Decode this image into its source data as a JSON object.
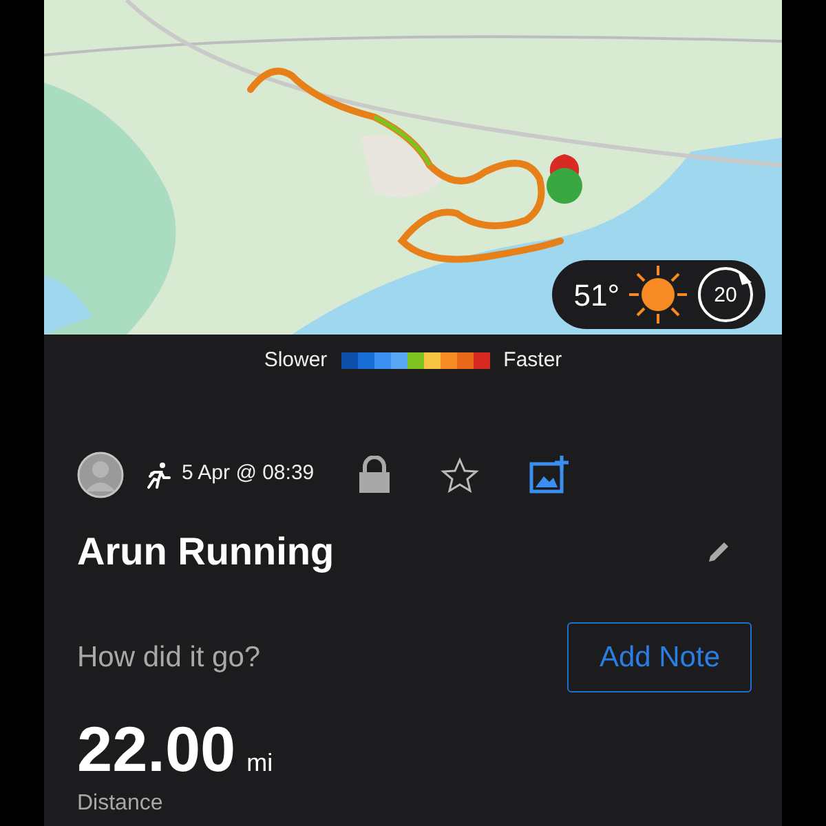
{
  "weather": {
    "temperature": "51°",
    "wind_speed": "20"
  },
  "speed_legend": {
    "slow_label": "Slower",
    "fast_label": "Faster",
    "swatches": [
      {
        "color": "#0d4fa8"
      },
      {
        "color": "#1a6fd6"
      },
      {
        "color": "#3b8ff0"
      },
      {
        "color": "#5aa8f5"
      },
      {
        "color": "#7ec322"
      },
      {
        "color": "#f9c544"
      },
      {
        "color": "#f68a24"
      },
      {
        "color": "#e8681a"
      },
      {
        "color": "#d72a22"
      }
    ]
  },
  "activity": {
    "date": "5 Apr @ 08:39",
    "title": "Arun Running",
    "note_prompt": "How did it go?",
    "note_button": "Add Note",
    "starred": false
  },
  "stats": [
    {
      "value": "22.00",
      "unit": "mi",
      "label": "Distance"
    }
  ]
}
